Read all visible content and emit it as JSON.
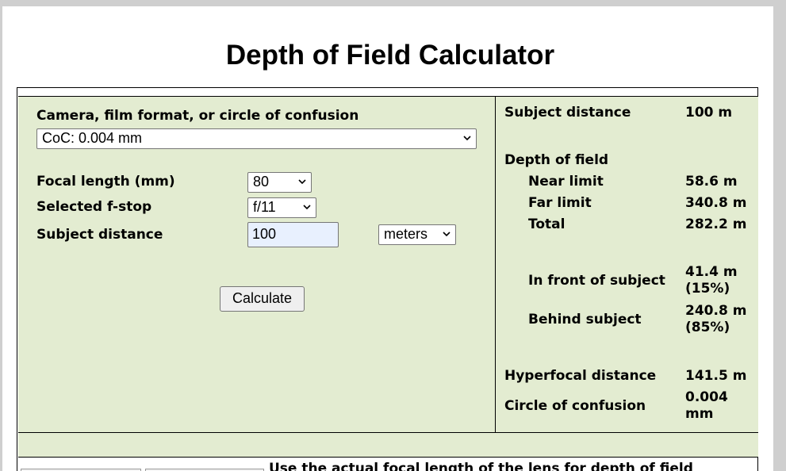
{
  "page": {
    "title": "Depth of Field Calculator"
  },
  "form": {
    "coc_label": "Camera, film format, or circle of confusion",
    "coc_value": "CoC: 0.004 mm",
    "focal_label": "Focal length (mm)",
    "focal_value": "80",
    "fstop_label": "Selected f-stop",
    "fstop_value": "f/11",
    "distance_label": "Subject distance",
    "distance_value": "100",
    "unit_value": "meters",
    "calculate_label": "Calculate"
  },
  "results": {
    "subject_distance_label": "Subject distance",
    "subject_distance_value": "100 m",
    "dof_heading": "Depth of field",
    "near_label": "Near limit",
    "near_value": "58.6 m",
    "far_label": "Far limit",
    "far_value": "340.8 m",
    "total_label": "Total",
    "total_value": "282.2 m",
    "front_label": "In front of subject",
    "front_value_line1": "41.4 m",
    "front_value_line2": "(15%)",
    "behind_label": "Behind subject",
    "behind_value_line1": "240.8 m",
    "behind_value_line2": "(85%)",
    "hyperfocal_label": "Hyperfocal distance",
    "hyperfocal_value": "141.5 m",
    "coc_label": "Circle of confusion",
    "coc_value_line1": "0.004",
    "coc_value_line2": "mm"
  },
  "lower": {
    "text": "Use the actual focal length of the lens for depth of field"
  },
  "colors": {
    "panel_bg": "#e3ecd1",
    "input_bg": "#e8f0fe"
  }
}
